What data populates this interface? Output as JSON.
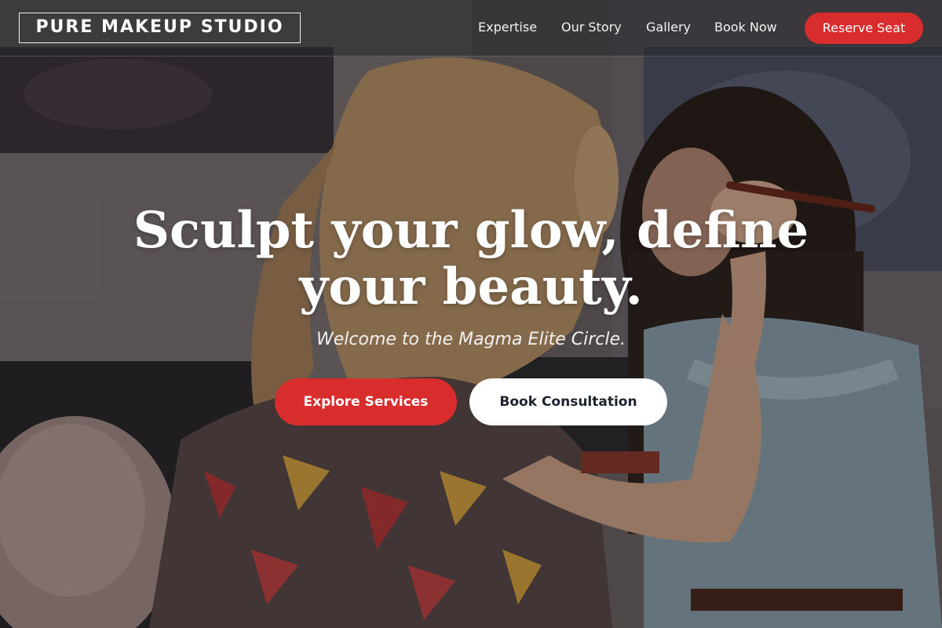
{
  "brand": {
    "logo_text": "PURE MAKEUP STUDIO"
  },
  "nav": {
    "links": [
      "Expertise",
      "Our Story",
      "Gallery",
      "Book Now"
    ],
    "reserve_label": "Reserve Seat"
  },
  "hero": {
    "headline_line1": "Sculpt your glow, define",
    "headline_line2": "your beauty.",
    "tagline": "Welcome to the Magma Elite Circle.",
    "primary_button": "Explore Services",
    "secondary_button": "Book Consultation"
  },
  "colors": {
    "accent": "#d92c2c",
    "button_text_dark": "#1c2330",
    "header_bg": "rgba(40,40,44,0.55)"
  }
}
